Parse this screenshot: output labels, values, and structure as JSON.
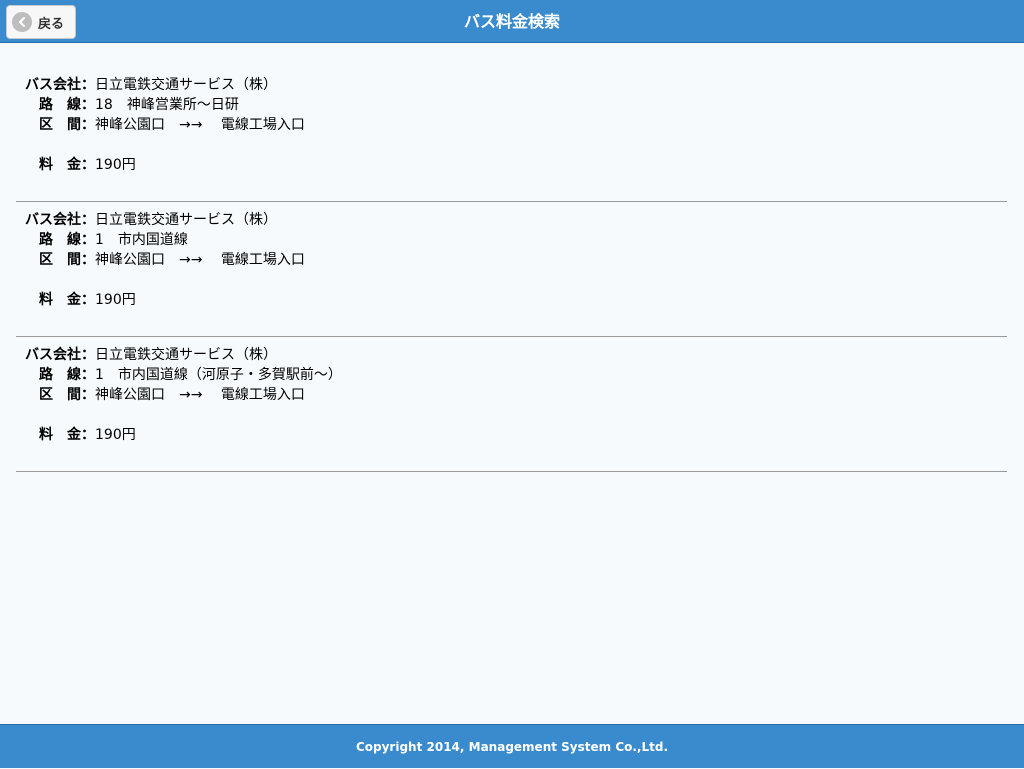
{
  "header": {
    "back_label": "戻る",
    "title": "バス料金検索"
  },
  "results": [
    {
      "company_label": "バス会社：",
      "company": "日立電鉄交通サービス（株）",
      "route_label": "路　線：",
      "route": "18　神峰営業所〜日研",
      "section_label": "区　間：",
      "section": "神峰公園口　→→　 電線工場入口",
      "fare_label": "料　金：",
      "fare": "190円"
    },
    {
      "company_label": "バス会社：",
      "company": "日立電鉄交通サービス（株）",
      "route_label": "路　線：",
      "route": "1　市内国道線",
      "section_label": "区　間：",
      "section": "神峰公園口　→→　 電線工場入口",
      "fare_label": "料　金：",
      "fare": "190円"
    },
    {
      "company_label": "バス会社：",
      "company": "日立電鉄交通サービス（株）",
      "route_label": "路　線：",
      "route": "1　市内国道線（河原子・多賀駅前〜）",
      "section_label": "区　間：",
      "section": "神峰公園口　→→　 電線工場入口",
      "fare_label": "料　金：",
      "fare": "190円"
    }
  ],
  "footer": {
    "copyright": "Copyright 2014, Management System Co.,Ltd."
  },
  "colors": {
    "header_bg": "#3a8bcd",
    "page_bg": "#f6fafd"
  },
  "icons": {
    "back": "chevron-left-icon"
  }
}
